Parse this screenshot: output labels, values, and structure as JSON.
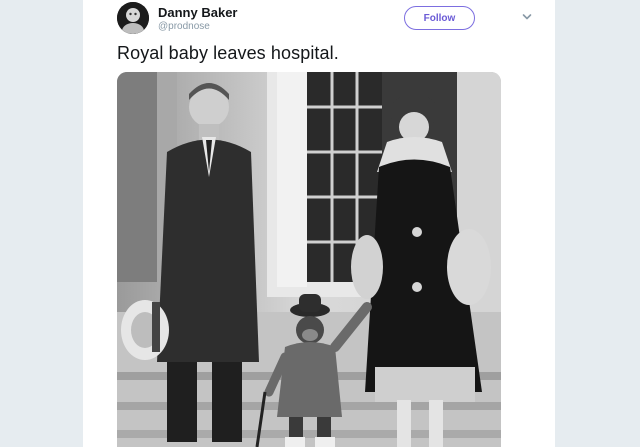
{
  "tweet": {
    "author": {
      "display_name": "Danny Baker",
      "handle": "@prodnose"
    },
    "follow_label": "Follow",
    "text": "Royal baby leaves hospital.",
    "media": {
      "icon": "photo-image"
    }
  },
  "colors": {
    "background_side": "#e6ecf0",
    "accent": "#6b5bd6",
    "text": "#14171a",
    "muted": "#8899a6"
  }
}
